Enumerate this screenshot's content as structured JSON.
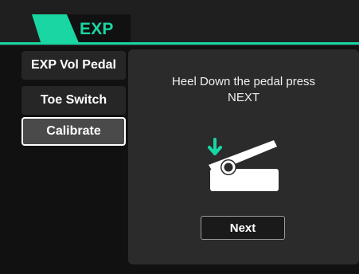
{
  "header": {
    "tab_label": "EXP",
    "accent_color": "#19d6a2"
  },
  "sidebar": {
    "items": [
      {
        "label": "EXP Vol Pedal",
        "active": false
      },
      {
        "label": "Toe Switch",
        "active": false
      },
      {
        "label": "Calibrate",
        "active": true
      }
    ]
  },
  "panel": {
    "instruction_line1": "Heel Down the pedal press",
    "instruction_line2": "NEXT",
    "illustration_icon": "pedal-heel-down-icon",
    "next_label": "Next"
  }
}
